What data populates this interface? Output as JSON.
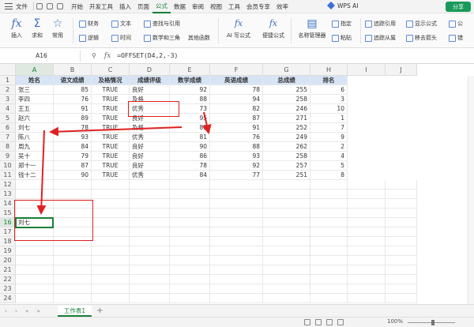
{
  "menu": {
    "items": [
      "文件",
      "开始",
      "开发工具",
      "插入",
      "页面",
      "公式",
      "数据",
      "审阅",
      "视图",
      "工具",
      "会员专享",
      "效率"
    ],
    "active": "公式",
    "ai_label": "WPS AI",
    "share_label": "分享"
  },
  "ribbon": {
    "insert_fn": "插入",
    "sum": "求和",
    "common": "常用",
    "finance": "财务",
    "logic": "逻辑",
    "text": "文本",
    "time": "时间",
    "lookup": "查找与引用",
    "math": "数学和三角",
    "other": "其他函数",
    "ai_formula": "AI 写公式",
    "quick_formula": "便捷公式",
    "name_mgr": "名称管理器",
    "specify": "指定",
    "paste": "粘贴",
    "trace_prec": "追踪引用",
    "trace_dep": "追踪从属",
    "show_formula": "显示公式",
    "remove_arrows": "移去箭头",
    "formula_audit": "公",
    "error_check": "错"
  },
  "formula_bar": {
    "name_box": "A16",
    "formula": "=OFFSET(D4,2,-3)"
  },
  "columns": [
    "A",
    "B",
    "C",
    "D",
    "E",
    "F",
    "G",
    "H",
    "I",
    "J"
  ],
  "rows": [
    "1",
    "2",
    "3",
    "4",
    "5",
    "6",
    "7",
    "8",
    "9",
    "10",
    "11",
    "12",
    "13",
    "14",
    "15",
    "16",
    "17",
    "18",
    "19",
    "20",
    "21",
    "22",
    "23",
    "24"
  ],
  "headers": [
    "姓名",
    "语文成绩",
    "及格情况",
    "成绩评级",
    "数学成绩",
    "英语成绩",
    "总成绩",
    "排名"
  ],
  "table": [
    [
      "张三",
      "85",
      "TRUE",
      "良好",
      "92",
      "78",
      "255",
      "6"
    ],
    [
      "李四",
      "76",
      "TRUE",
      "及格",
      "88",
      "94",
      "258",
      "3"
    ],
    [
      "王五",
      "91",
      "TRUE",
      "优秀",
      "73",
      "82",
      "246",
      "10"
    ],
    [
      "赵六",
      "89",
      "TRUE",
      "良好",
      "95",
      "87",
      "271",
      "1"
    ],
    [
      "刘七",
      "78",
      "TRUE",
      "及格",
      "83",
      "91",
      "252",
      "7"
    ],
    [
      "陈八",
      "93",
      "TRUE",
      "优秀",
      "81",
      "76",
      "249",
      "9"
    ],
    [
      "周九",
      "84",
      "TRUE",
      "良好",
      "90",
      "88",
      "262",
      "2"
    ],
    [
      "吴十",
      "79",
      "TRUE",
      "良好",
      "86",
      "93",
      "258",
      "4"
    ],
    [
      "郑十一",
      "87",
      "TRUE",
      "良好",
      "78",
      "92",
      "257",
      "5"
    ],
    [
      "钱十二",
      "90",
      "TRUE",
      "优秀",
      "84",
      "77",
      "251",
      "8"
    ]
  ],
  "result_cell": "刘七",
  "sheet": {
    "tab": "工作表1"
  },
  "status": {
    "zoom": "100%"
  },
  "annotation_color": "#e02020",
  "accent_color": "#1a7f37"
}
